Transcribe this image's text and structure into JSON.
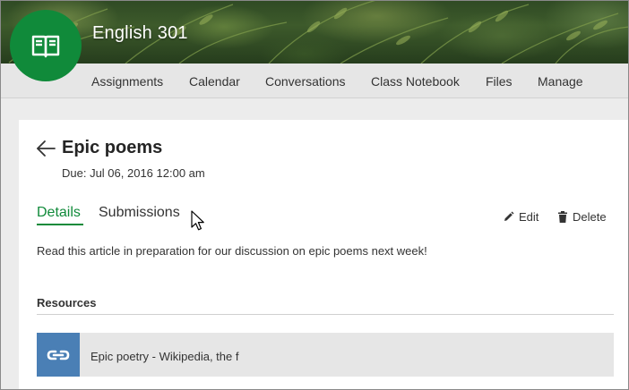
{
  "course": {
    "title": "English 301",
    "logo_icon": "open-book-icon",
    "logo_color": "#108a3a"
  },
  "nav": {
    "items": [
      {
        "label": "Assignments"
      },
      {
        "label": "Calendar"
      },
      {
        "label": "Conversations"
      },
      {
        "label": "Class Notebook"
      },
      {
        "label": "Files"
      },
      {
        "label": "Manage"
      }
    ]
  },
  "assignment": {
    "title": "Epic poems",
    "due": "Due: Jul 06, 2016 12:00 am",
    "tabs": [
      {
        "label": "Details",
        "active": true
      },
      {
        "label": "Submissions",
        "active": false
      }
    ],
    "actions": {
      "edit_label": "Edit",
      "edit_icon": "pencil-icon",
      "delete_label": "Delete",
      "delete_icon": "trash-icon"
    },
    "description": "Read this article in preparation for our discussion on epic poems next week!",
    "resources_label": "Resources",
    "resources": [
      {
        "icon": "link-icon",
        "title": "Epic poetry - Wikipedia, the f",
        "icon_color": "#4a7fb5"
      }
    ]
  },
  "accent_color": "#108a3a"
}
